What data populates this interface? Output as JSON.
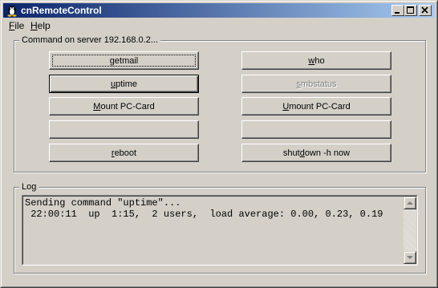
{
  "window": {
    "title": "cnRemoteControl"
  },
  "menu": {
    "file": {
      "mnemonic": "F",
      "rest": "ile"
    },
    "help": {
      "mnemonic": "H",
      "rest": "elp"
    }
  },
  "commands_group": {
    "label": "Command on server 192.168.0.2...",
    "buttons": {
      "getmail": {
        "pre": "",
        "mnemonic": "g",
        "post": "etmail"
      },
      "who": {
        "pre": "",
        "mnemonic": "w",
        "post": "ho"
      },
      "uptime": {
        "pre": "",
        "mnemonic": "u",
        "post": "ptime"
      },
      "smbstatus": {
        "pre": "",
        "mnemonic": "s",
        "post": "mbstatus"
      },
      "mount": {
        "pre": "",
        "mnemonic": "M",
        "post": "ount PC-Card"
      },
      "umount": {
        "pre": "",
        "mnemonic": "U",
        "post": "mount PC-Card"
      },
      "empty1": {
        "label": ""
      },
      "empty2": {
        "label": ""
      },
      "reboot": {
        "pre": "",
        "mnemonic": "r",
        "post": "eboot"
      },
      "shutdown": {
        "pre": "shut",
        "mnemonic": "d",
        "post": "own -h now"
      }
    }
  },
  "log_group": {
    "label": "Log",
    "lines": [
      "Sending command \"uptime\"...",
      " 22:00:11  up  1:15,  2 users,  load average: 0.00, 0.23, 0.19"
    ]
  },
  "colors": {
    "titlebar_start": "#0a246a",
    "titlebar_end": "#a6caf0",
    "face": "#d4d0c8"
  }
}
